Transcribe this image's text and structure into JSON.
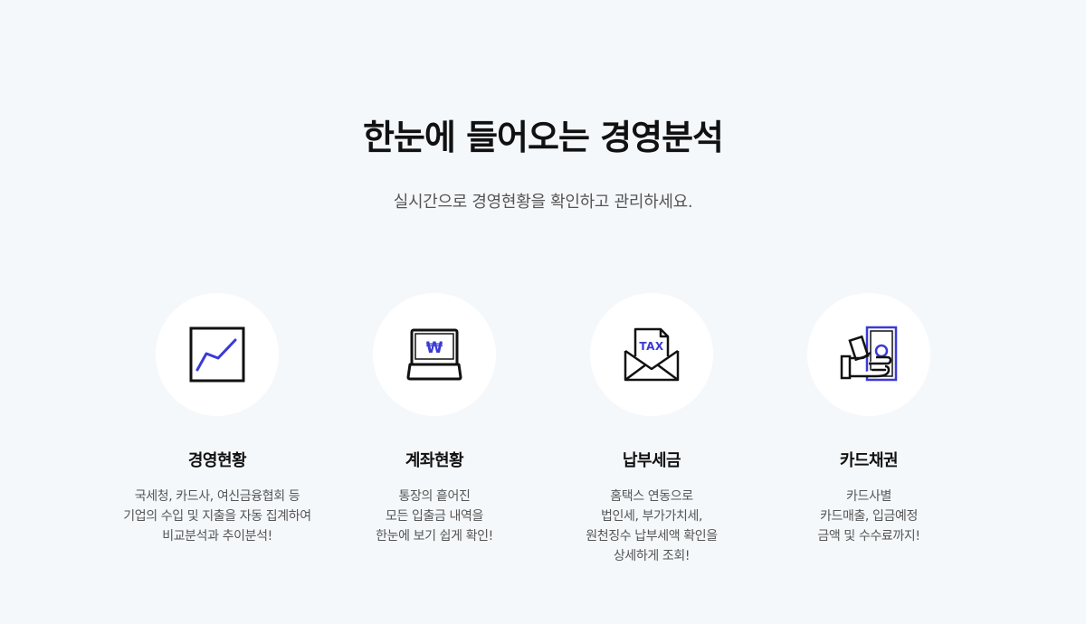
{
  "heading": {
    "title": "한눈에 들어오는 경영분석",
    "subtitle": "실시간으로 경영현황을 확인하고 관리하세요."
  },
  "features": [
    {
      "name": "경영현황",
      "icon": "line-chart-icon",
      "lines": [
        "국세청, 카드사, 여신금융협회 등",
        "기업의 수입 및 지출을 자동 집계하여",
        "비교분석과 추이분석!"
      ]
    },
    {
      "name": "계좌현황",
      "icon": "won-laptop-icon",
      "icon_text": "₩",
      "lines": [
        "통장의 흩어진",
        "모든 입출금 내역을",
        "한눈에 보기 쉽게 확인!"
      ]
    },
    {
      "name": "납부세금",
      "icon": "tax-envelope-icon",
      "icon_text": "TAX",
      "lines": [
        "홈택스 연동으로",
        "법인세, 부가가치세,",
        "원천징수 납부세액 확인을",
        "상세하게 조회!"
      ]
    },
    {
      "name": "카드채권",
      "icon": "hand-money-icon",
      "lines": [
        "카드사별",
        "카드매출, 입금예정",
        "금액 및 수수료까지!"
      ]
    }
  ],
  "colors": {
    "background": "#f5f8fb",
    "accent": "#3a3ad6",
    "icon_stroke": "#111111",
    "text_primary": "#111111",
    "text_secondary": "#555555"
  }
}
